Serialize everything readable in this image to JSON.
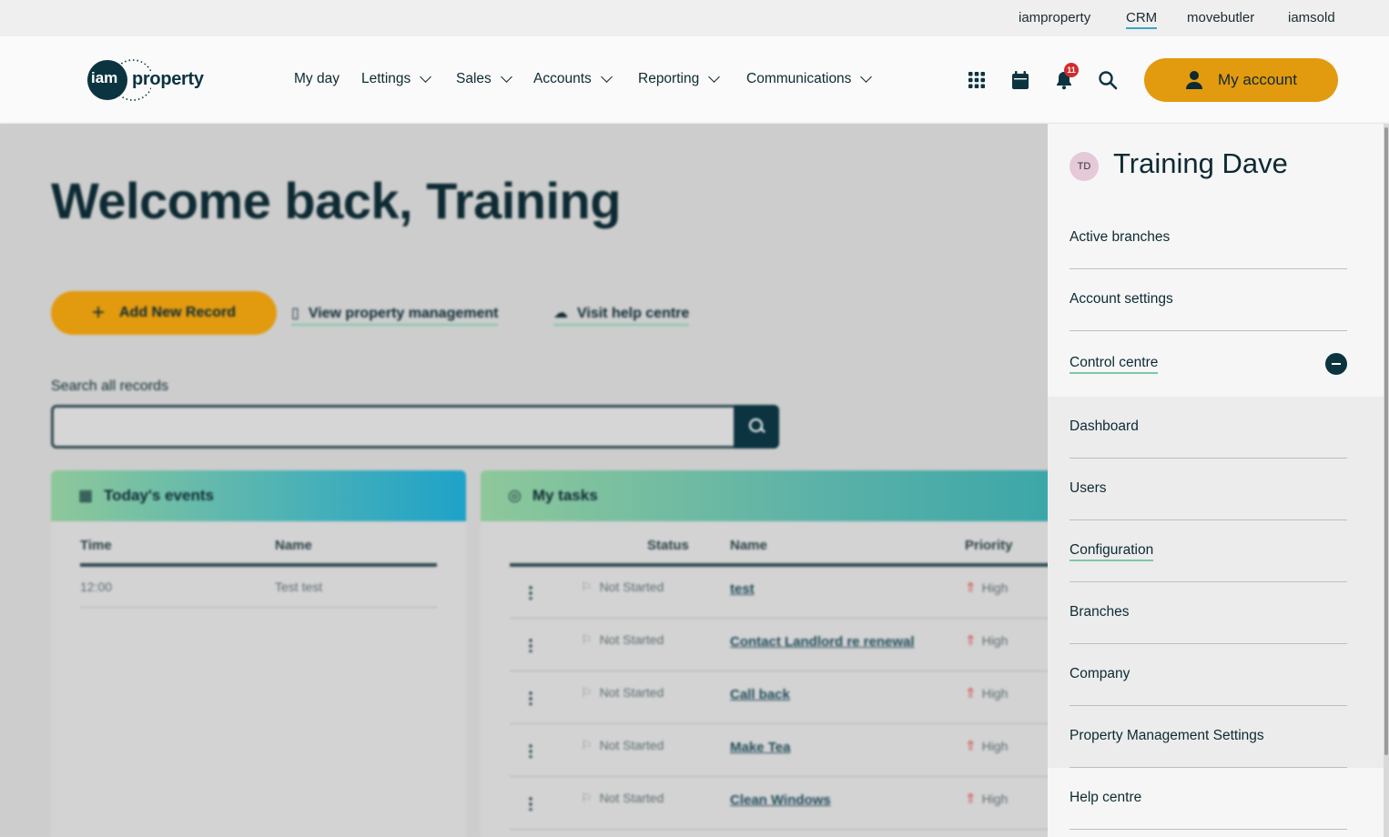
{
  "topbar": {
    "links": [
      "iamproperty",
      "CRM",
      "movebutler",
      "iamsold"
    ],
    "active": "CRM"
  },
  "header": {
    "logo_mark": "iam",
    "logo_text": "property",
    "nav": [
      "My day",
      "Lettings",
      "Sales",
      "Accounts",
      "Reporting",
      "Communications"
    ],
    "notification_count": "11",
    "account_button": "My account",
    "icons": [
      "apps-grid-icon",
      "calendar-icon",
      "bell-icon",
      "search-icon",
      "user-icon"
    ]
  },
  "main": {
    "welcome": "Welcome back, Training",
    "add_record": "Add New Record",
    "view_pm": "View property management",
    "help_centre": "Visit help centre",
    "search_label": "Search all records",
    "events": {
      "title": "Today's events",
      "columns": [
        "Time",
        "Name"
      ],
      "rows": [
        [
          "12:00",
          "Test test"
        ]
      ]
    },
    "tasks": {
      "title": "My tasks",
      "columns": [
        "Status",
        "Name",
        "Priority"
      ],
      "rows": [
        {
          "status": "Not Started",
          "name": "test",
          "priority": "High"
        },
        {
          "status": "Not Started",
          "name": "Contact Landlord re renewal",
          "priority": "High"
        },
        {
          "status": "Not Started",
          "name": "Call back",
          "priority": "High"
        },
        {
          "status": "Not Started",
          "name": "Make Tea",
          "priority": "High"
        },
        {
          "status": "Not Started",
          "name": "Clean Windows",
          "priority": "High"
        }
      ]
    }
  },
  "account_menu": {
    "initials": "TD",
    "name": "Training Dave",
    "items": [
      "Active branches",
      "Account settings",
      "Control centre"
    ],
    "control_centre_items": [
      "Dashboard",
      "Users",
      "Configuration",
      "Branches",
      "Company",
      "Property Management Settings"
    ],
    "footer_items": [
      "Help centre"
    ]
  }
}
